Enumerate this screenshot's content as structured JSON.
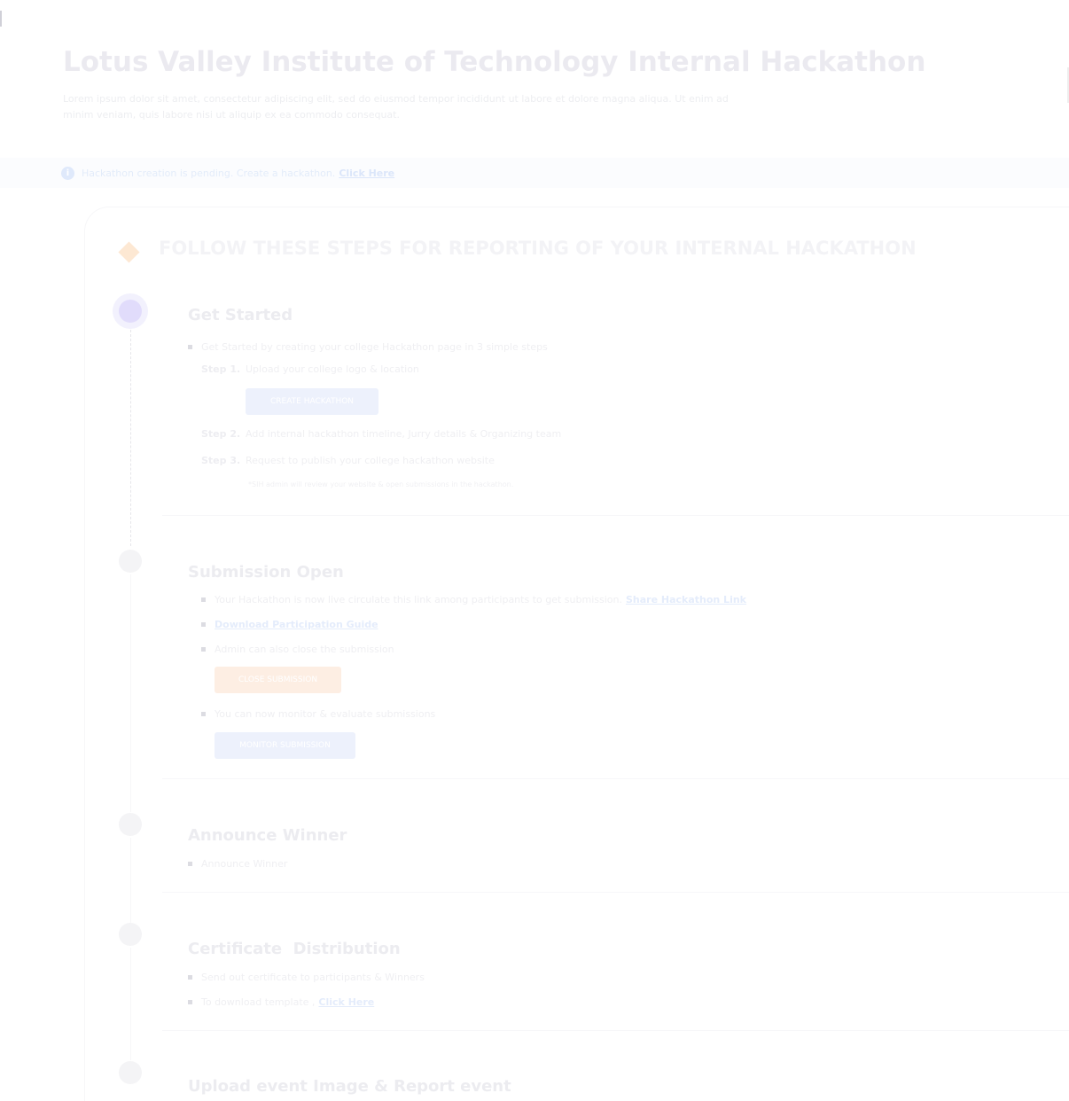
{
  "header": {
    "title": "Lotus Valley Institute of Technology Internal Hackathon",
    "description": "Lorem ipsum dolor sit amet, consectetur adipiscing elit, sed do eiusmod tempor incididunt ut labore et dolore magna aliqua. Ut enim ad minim veniam, quis labore nisi ut aliquip ex ea commodo consequat."
  },
  "alert": {
    "icon": "info-icon",
    "text": "Hackathon creation is pending. Create a hackathon.",
    "link_label": "Click Here"
  },
  "steps_section": {
    "heading": "FOLLOW THESE STEPS FOR REPORTING OF YOUR INTERNAL HACKATHON"
  },
  "stages": {
    "get_started": {
      "title": "Get Started",
      "intro": "Get Started by creating your college Hackathon page in 3 simple steps",
      "step1_num": "Step 1.",
      "step1_text": "Upload your college logo & location",
      "create_button": "CREATE HACKATHON",
      "step2_num": "Step 2.",
      "step2_text": "Add internal hackathon timeline, Jurry details & Organizing team",
      "step3_num": "Step 3.",
      "step3_text": "Request to publish your college hackathon website",
      "note": "*SIH admin will review your website & open submissions in the hackathon."
    },
    "submission_open": {
      "title": "Submission Open",
      "bullet1_text": "Your Hackathon is now live circulate this link among participants to get submission.",
      "bullet1_link": "Share Hackathon Link",
      "bullet2_link": "Download Participation Guide",
      "bullet3_text": "Admin can also close the submission",
      "close_button": "CLOSE SUBMISSION",
      "bullet4_text": "You can now monitor & evaluate submissions",
      "monitor_button": "MONITOR SUBMISSION"
    },
    "announce_winner": {
      "title": "Announce Winner",
      "bullet1_text": "Announce Winner"
    },
    "certificate": {
      "title": "Certificate  Distribution",
      "bullet1_text": "Send out certificate to participants & Winners",
      "bullet2_text": "To download template ,",
      "bullet2_link": "Click Here"
    },
    "upload_event": {
      "title": "Upload event Image & Report event"
    }
  }
}
